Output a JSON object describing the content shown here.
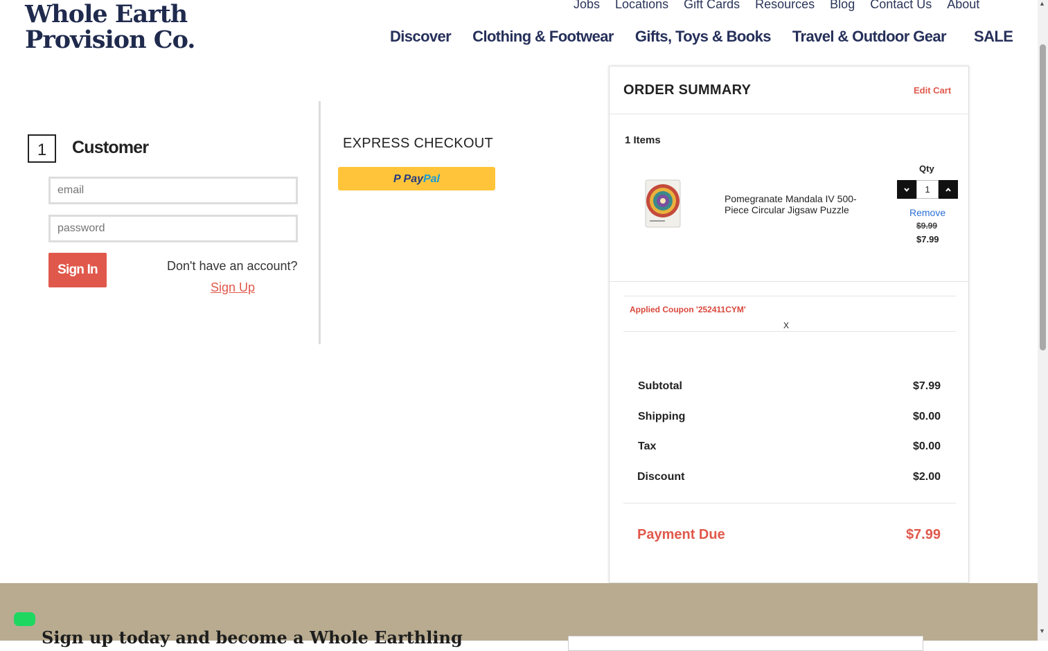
{
  "brand": {
    "line1": "Whole Earth",
    "line2": "Provision Co."
  },
  "top_links": [
    "Jobs",
    "Locations",
    "Gift Cards",
    "Resources",
    "Blog",
    "Contact Us",
    "About"
  ],
  "main_nav": [
    "Discover",
    "Clothing & Footwear",
    "Gifts, Toys & Books",
    "Travel & Outdoor Gear",
    "SALE"
  ],
  "customer": {
    "step": "1",
    "title": "Customer",
    "email_placeholder": "email",
    "password_placeholder": "password",
    "signin_label": "Sign In",
    "no_account": "Don't have an account?",
    "signup_label": "Sign Up"
  },
  "express": {
    "title": "EXPRESS CHECKOUT",
    "paypal_p1": "Pay",
    "paypal_p2": "Pal"
  },
  "summary": {
    "title": "ORDER SUMMARY",
    "edit_cart": "Edit Cart",
    "items_count": "1 Items",
    "item": {
      "name": "Pomegranate Mandala IV 500-Piece Circular Jigsaw Puzzle",
      "qty_label": "Qty",
      "qty": "1",
      "remove": "Remove",
      "old_price": "$9.99",
      "price": "$7.99"
    },
    "coupon": "Applied Coupon '252411CYM'",
    "coupon_remove": "X",
    "rows": [
      {
        "label": "Subtotal",
        "value": "$7.99"
      },
      {
        "label": "Shipping",
        "value": "$0.00"
      },
      {
        "label": "Tax",
        "value": "$0.00"
      },
      {
        "label": "Discount",
        "value": "$2.00"
      }
    ],
    "due_label": "Payment Due",
    "due_value": "$7.99"
  },
  "footer": {
    "signup_text": "Sign up today and become a Whole Earthling"
  },
  "colors": {
    "accent": "#e0584b",
    "navy": "#1f2a4d",
    "paypal": "#ffc439",
    "footer": "#b8ab90"
  }
}
